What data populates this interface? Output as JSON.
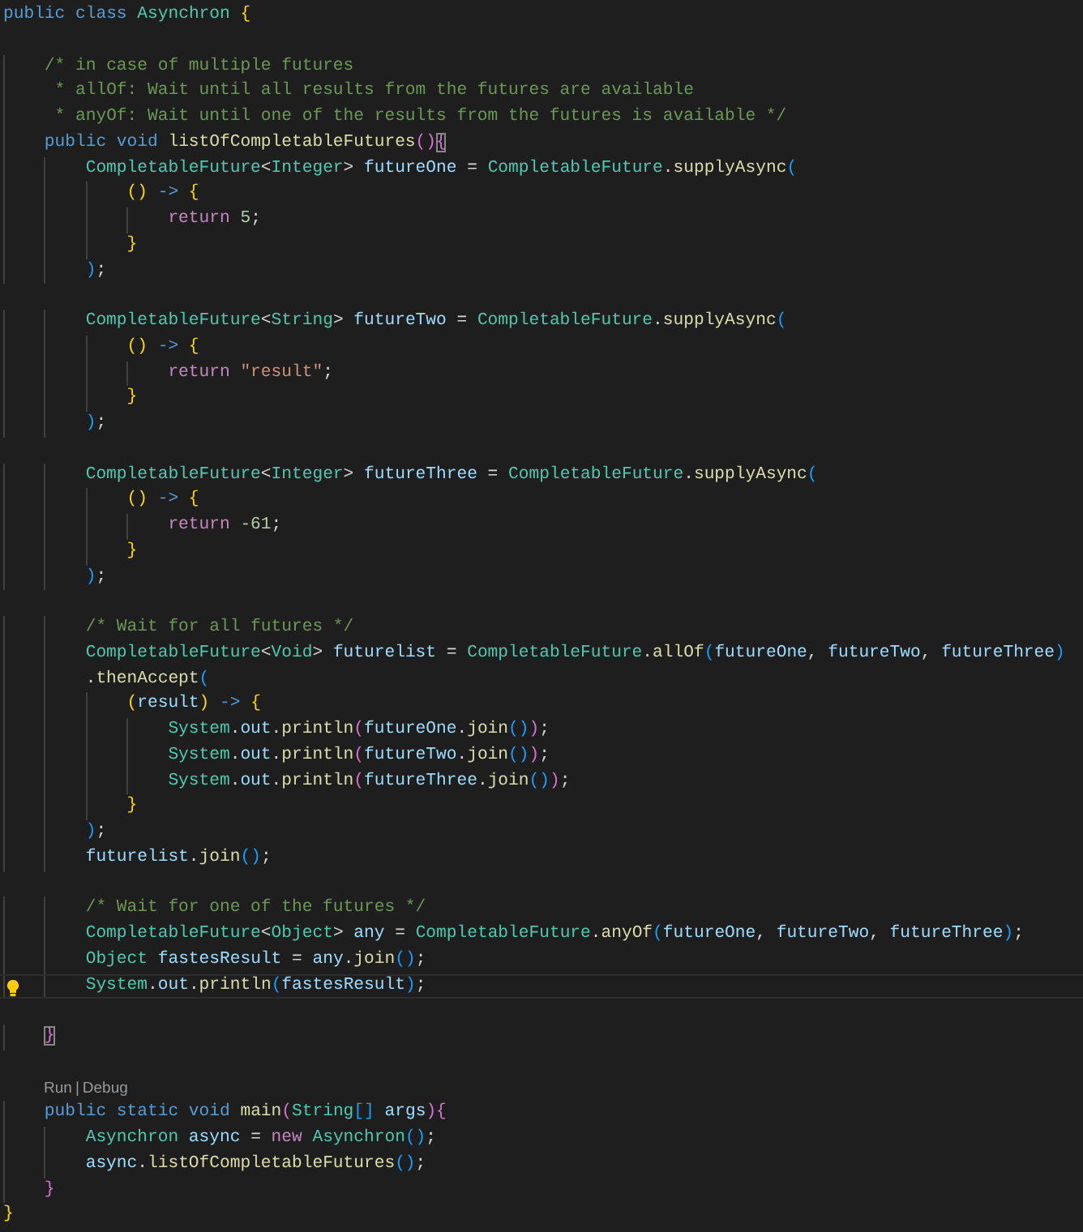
{
  "editor": {
    "lines": [
      {
        "kind": "code",
        "current": false,
        "tokens": [
          {
            "kind": "kw",
            "text": "public class "
          },
          {
            "kind": "type",
            "text": "Asynchron "
          },
          {
            "kind": "b1",
            "text": "{"
          }
        ],
        "children": [
          {
            "kind": "blank"
          },
          {
            "kind": "code",
            "current": false,
            "tokens": [
              {
                "kind": "cm",
                "text": "/* in case of multiple futures"
              }
            ]
          },
          {
            "kind": "code",
            "current": false,
            "tokens": [
              {
                "kind": "cm",
                "text": " * allOf: Wait until all results from the futures are available"
              }
            ]
          },
          {
            "kind": "code",
            "current": false,
            "tokens": [
              {
                "kind": "cm",
                "text": " * anyOf: Wait until one of the results from the futures is available */"
              }
            ]
          },
          {
            "kind": "code",
            "current": false,
            "tokens": [
              {
                "kind": "kw",
                "text": "public void "
              },
              {
                "kind": "fn",
                "text": "listOfCompletableFutures"
              },
              {
                "kind": "b2",
                "text": "()"
              },
              {
                "kind": "b2",
                "text": "{",
                "matched": true
              }
            ],
            "children": [
              {
                "kind": "code",
                "current": false,
                "tokens": [
                  {
                    "kind": "type",
                    "text": "CompletableFuture"
                  },
                  {
                    "kind": "op",
                    "text": "<"
                  },
                  {
                    "kind": "type",
                    "text": "Integer"
                  },
                  {
                    "kind": "op",
                    "text": "> "
                  },
                  {
                    "kind": "var",
                    "text": "futureOne"
                  },
                  {
                    "kind": "op",
                    "text": " = "
                  },
                  {
                    "kind": "type",
                    "text": "CompletableFuture"
                  },
                  {
                    "kind": "op",
                    "text": "."
                  },
                  {
                    "kind": "fn",
                    "text": "supplyAsync"
                  },
                  {
                    "kind": "b3",
                    "text": "("
                  }
                ],
                "children": [
                  {
                    "kind": "code",
                    "current": false,
                    "tokens": [
                      {
                        "kind": "b1",
                        "text": "()"
                      },
                      {
                        "kind": "kw",
                        "text": " -> "
                      },
                      {
                        "kind": "b1",
                        "text": "{"
                      }
                    ],
                    "children": [
                      {
                        "kind": "code",
                        "current": false,
                        "tokens": [
                          {
                            "kind": "ctl",
                            "text": "return "
                          },
                          {
                            "kind": "num",
                            "text": "5"
                          },
                          {
                            "kind": "op",
                            "text": ";"
                          }
                        ]
                      }
                    ]
                  },
                  {
                    "kind": "code",
                    "current": false,
                    "tokens": [
                      {
                        "kind": "b1",
                        "text": "}"
                      }
                    ]
                  }
                ]
              },
              {
                "kind": "code",
                "current": false,
                "tokens": [
                  {
                    "kind": "b3",
                    "text": ")"
                  },
                  {
                    "kind": "op",
                    "text": ";"
                  }
                ]
              },
              {
                "kind": "blank"
              },
              {
                "kind": "code",
                "current": false,
                "tokens": [
                  {
                    "kind": "type",
                    "text": "CompletableFuture"
                  },
                  {
                    "kind": "op",
                    "text": "<"
                  },
                  {
                    "kind": "type",
                    "text": "String"
                  },
                  {
                    "kind": "op",
                    "text": "> "
                  },
                  {
                    "kind": "var",
                    "text": "futureTwo"
                  },
                  {
                    "kind": "op",
                    "text": " = "
                  },
                  {
                    "kind": "type",
                    "text": "CompletableFuture"
                  },
                  {
                    "kind": "op",
                    "text": "."
                  },
                  {
                    "kind": "fn",
                    "text": "supplyAsync"
                  },
                  {
                    "kind": "b3",
                    "text": "("
                  }
                ],
                "children": [
                  {
                    "kind": "code",
                    "current": false,
                    "tokens": [
                      {
                        "kind": "b1",
                        "text": "()"
                      },
                      {
                        "kind": "kw",
                        "text": " -> "
                      },
                      {
                        "kind": "b1",
                        "text": "{"
                      }
                    ],
                    "children": [
                      {
                        "kind": "code",
                        "current": false,
                        "tokens": [
                          {
                            "kind": "ctl",
                            "text": "return "
                          },
                          {
                            "kind": "str",
                            "text": "\"result\""
                          },
                          {
                            "kind": "op",
                            "text": ";"
                          }
                        ]
                      }
                    ]
                  },
                  {
                    "kind": "code",
                    "current": false,
                    "tokens": [
                      {
                        "kind": "b1",
                        "text": "}"
                      }
                    ]
                  }
                ]
              },
              {
                "kind": "code",
                "current": false,
                "tokens": [
                  {
                    "kind": "b3",
                    "text": ")"
                  },
                  {
                    "kind": "op",
                    "text": ";"
                  }
                ]
              },
              {
                "kind": "blank"
              },
              {
                "kind": "code",
                "current": false,
                "tokens": [
                  {
                    "kind": "type",
                    "text": "CompletableFuture"
                  },
                  {
                    "kind": "op",
                    "text": "<"
                  },
                  {
                    "kind": "type",
                    "text": "Integer"
                  },
                  {
                    "kind": "op",
                    "text": "> "
                  },
                  {
                    "kind": "var",
                    "text": "futureThree"
                  },
                  {
                    "kind": "op",
                    "text": " = "
                  },
                  {
                    "kind": "type",
                    "text": "CompletableFuture"
                  },
                  {
                    "kind": "op",
                    "text": "."
                  },
                  {
                    "kind": "fn",
                    "text": "supplyAsync"
                  },
                  {
                    "kind": "b3",
                    "text": "("
                  }
                ],
                "children": [
                  {
                    "kind": "code",
                    "current": false,
                    "tokens": [
                      {
                        "kind": "b1",
                        "text": "()"
                      },
                      {
                        "kind": "kw",
                        "text": " -> "
                      },
                      {
                        "kind": "b1",
                        "text": "{"
                      }
                    ],
                    "children": [
                      {
                        "kind": "code",
                        "current": false,
                        "tokens": [
                          {
                            "kind": "ctl",
                            "text": "return "
                          },
                          {
                            "kind": "num",
                            "text": "-61"
                          },
                          {
                            "kind": "op",
                            "text": ";"
                          }
                        ]
                      }
                    ]
                  },
                  {
                    "kind": "code",
                    "current": false,
                    "tokens": [
                      {
                        "kind": "b1",
                        "text": "}"
                      }
                    ]
                  }
                ]
              },
              {
                "kind": "code",
                "current": false,
                "tokens": [
                  {
                    "kind": "b3",
                    "text": ")"
                  },
                  {
                    "kind": "op",
                    "text": ";"
                  }
                ]
              },
              {
                "kind": "blank"
              },
              {
                "kind": "code",
                "current": false,
                "tokens": [
                  {
                    "kind": "cm",
                    "text": "/* Wait for all futures */"
                  }
                ]
              },
              {
                "kind": "code",
                "current": false,
                "tokens": [
                  {
                    "kind": "type",
                    "text": "CompletableFuture"
                  },
                  {
                    "kind": "op",
                    "text": "<"
                  },
                  {
                    "kind": "type",
                    "text": "Void"
                  },
                  {
                    "kind": "op",
                    "text": "> "
                  },
                  {
                    "kind": "var",
                    "text": "futurelist"
                  },
                  {
                    "kind": "op",
                    "text": " = "
                  },
                  {
                    "kind": "type",
                    "text": "CompletableFuture"
                  },
                  {
                    "kind": "op",
                    "text": "."
                  },
                  {
                    "kind": "fn",
                    "text": "allOf"
                  },
                  {
                    "kind": "b3",
                    "text": "("
                  },
                  {
                    "kind": "var",
                    "text": "futureOne"
                  },
                  {
                    "kind": "op",
                    "text": ", "
                  },
                  {
                    "kind": "var",
                    "text": "futureTwo"
                  },
                  {
                    "kind": "op",
                    "text": ", "
                  },
                  {
                    "kind": "var",
                    "text": "futureThree"
                  },
                  {
                    "kind": "b3",
                    "text": ")"
                  }
                ]
              },
              {
                "kind": "code",
                "current": false,
                "tokens": [
                  {
                    "kind": "op",
                    "text": "."
                  },
                  {
                    "kind": "fn",
                    "text": "thenAccept"
                  },
                  {
                    "kind": "b3",
                    "text": "("
                  }
                ],
                "children": [
                  {
                    "kind": "code",
                    "current": false,
                    "tokens": [
                      {
                        "kind": "b1",
                        "text": "("
                      },
                      {
                        "kind": "var",
                        "text": "result"
                      },
                      {
                        "kind": "b1",
                        "text": ")"
                      },
                      {
                        "kind": "kw",
                        "text": " -> "
                      },
                      {
                        "kind": "b1",
                        "text": "{"
                      }
                    ],
                    "children": [
                      {
                        "kind": "code",
                        "current": false,
                        "tokens": [
                          {
                            "kind": "type",
                            "text": "System"
                          },
                          {
                            "kind": "op",
                            "text": "."
                          },
                          {
                            "kind": "var",
                            "text": "out"
                          },
                          {
                            "kind": "op",
                            "text": "."
                          },
                          {
                            "kind": "fn",
                            "text": "println"
                          },
                          {
                            "kind": "b2",
                            "text": "("
                          },
                          {
                            "kind": "var",
                            "text": "futureOne"
                          },
                          {
                            "kind": "op",
                            "text": "."
                          },
                          {
                            "kind": "fn",
                            "text": "join"
                          },
                          {
                            "kind": "b3",
                            "text": "()"
                          },
                          {
                            "kind": "b2",
                            "text": ")"
                          },
                          {
                            "kind": "op",
                            "text": ";"
                          }
                        ]
                      },
                      {
                        "kind": "code",
                        "current": false,
                        "tokens": [
                          {
                            "kind": "type",
                            "text": "System"
                          },
                          {
                            "kind": "op",
                            "text": "."
                          },
                          {
                            "kind": "var",
                            "text": "out"
                          },
                          {
                            "kind": "op",
                            "text": "."
                          },
                          {
                            "kind": "fn",
                            "text": "println"
                          },
                          {
                            "kind": "b2",
                            "text": "("
                          },
                          {
                            "kind": "var",
                            "text": "futureTwo"
                          },
                          {
                            "kind": "op",
                            "text": "."
                          },
                          {
                            "kind": "fn",
                            "text": "join"
                          },
                          {
                            "kind": "b3",
                            "text": "()"
                          },
                          {
                            "kind": "b2",
                            "text": ")"
                          },
                          {
                            "kind": "op",
                            "text": ";"
                          }
                        ]
                      },
                      {
                        "kind": "code",
                        "current": false,
                        "tokens": [
                          {
                            "kind": "type",
                            "text": "System"
                          },
                          {
                            "kind": "op",
                            "text": "."
                          },
                          {
                            "kind": "var",
                            "text": "out"
                          },
                          {
                            "kind": "op",
                            "text": "."
                          },
                          {
                            "kind": "fn",
                            "text": "println"
                          },
                          {
                            "kind": "b2",
                            "text": "("
                          },
                          {
                            "kind": "var",
                            "text": "futureThree"
                          },
                          {
                            "kind": "op",
                            "text": "."
                          },
                          {
                            "kind": "fn",
                            "text": "join"
                          },
                          {
                            "kind": "b3",
                            "text": "()"
                          },
                          {
                            "kind": "b2",
                            "text": ")"
                          },
                          {
                            "kind": "op",
                            "text": ";"
                          }
                        ]
                      }
                    ]
                  },
                  {
                    "kind": "code",
                    "current": false,
                    "tokens": [
                      {
                        "kind": "b1",
                        "text": "}"
                      }
                    ]
                  }
                ]
              },
              {
                "kind": "code",
                "current": false,
                "tokens": [
                  {
                    "kind": "b3",
                    "text": ")"
                  },
                  {
                    "kind": "op",
                    "text": ";"
                  }
                ]
              },
              {
                "kind": "code",
                "current": false,
                "tokens": [
                  {
                    "kind": "var",
                    "text": "futurelist"
                  },
                  {
                    "kind": "op",
                    "text": "."
                  },
                  {
                    "kind": "fn",
                    "text": "join"
                  },
                  {
                    "kind": "b3",
                    "text": "()"
                  },
                  {
                    "kind": "op",
                    "text": ";"
                  }
                ]
              },
              {
                "kind": "blank"
              },
              {
                "kind": "code",
                "current": false,
                "tokens": [
                  {
                    "kind": "cm",
                    "text": "/* Wait for one of the futures */"
                  }
                ]
              },
              {
                "kind": "code",
                "current": false,
                "tokens": [
                  {
                    "kind": "type",
                    "text": "CompletableFuture"
                  },
                  {
                    "kind": "op",
                    "text": "<"
                  },
                  {
                    "kind": "type",
                    "text": "Object"
                  },
                  {
                    "kind": "op",
                    "text": "> "
                  },
                  {
                    "kind": "var",
                    "text": "any"
                  },
                  {
                    "kind": "op",
                    "text": " = "
                  },
                  {
                    "kind": "type",
                    "text": "CompletableFuture"
                  },
                  {
                    "kind": "op",
                    "text": "."
                  },
                  {
                    "kind": "fn",
                    "text": "anyOf"
                  },
                  {
                    "kind": "b3",
                    "text": "("
                  },
                  {
                    "kind": "var",
                    "text": "futureOne"
                  },
                  {
                    "kind": "op",
                    "text": ", "
                  },
                  {
                    "kind": "var",
                    "text": "futureTwo"
                  },
                  {
                    "kind": "op",
                    "text": ", "
                  },
                  {
                    "kind": "var",
                    "text": "futureThree"
                  },
                  {
                    "kind": "b3",
                    "text": ")"
                  },
                  {
                    "kind": "op",
                    "text": ";"
                  }
                ]
              },
              {
                "kind": "code",
                "current": false,
                "tokens": [
                  {
                    "kind": "type",
                    "text": "Object "
                  },
                  {
                    "kind": "var",
                    "text": "fastesResult"
                  },
                  {
                    "kind": "op",
                    "text": " = "
                  },
                  {
                    "kind": "var",
                    "text": "any"
                  },
                  {
                    "kind": "op",
                    "text": "."
                  },
                  {
                    "kind": "fn",
                    "text": "join"
                  },
                  {
                    "kind": "b3",
                    "text": "()"
                  },
                  {
                    "kind": "op",
                    "text": ";"
                  }
                ]
              },
              {
                "kind": "code",
                "current": true,
                "lightbulb": true,
                "tokens": [
                  {
                    "kind": "type",
                    "text": "System"
                  },
                  {
                    "kind": "op",
                    "text": "."
                  },
                  {
                    "kind": "var",
                    "text": "out"
                  },
                  {
                    "kind": "op",
                    "text": "."
                  },
                  {
                    "kind": "fn",
                    "text": "println"
                  },
                  {
                    "kind": "b3",
                    "text": "("
                  },
                  {
                    "kind": "var",
                    "text": "fastesResult"
                  },
                  {
                    "kind": "b3",
                    "text": ")"
                  },
                  {
                    "kind": "op",
                    "text": ";"
                  }
                ]
              },
              {
                "kind": "blank"
              }
            ]
          },
          {
            "kind": "code",
            "current": false,
            "tokens": [
              {
                "kind": "b2",
                "text": "}",
                "matched": true
              }
            ]
          },
          {
            "kind": "blank"
          },
          {
            "kind": "codelens",
            "links": [
              "Run",
              "Debug"
            ],
            "separator": "|"
          },
          {
            "kind": "code",
            "current": false,
            "tokens": [
              {
                "kind": "kw",
                "text": "public static void "
              },
              {
                "kind": "fn",
                "text": "main"
              },
              {
                "kind": "b2",
                "text": "("
              },
              {
                "kind": "type",
                "text": "String"
              },
              {
                "kind": "b3",
                "text": "[]"
              },
              {
                "kind": "var",
                "text": " args"
              },
              {
                "kind": "b2",
                "text": ")"
              },
              {
                "kind": "b2",
                "text": "{"
              }
            ],
            "children": [
              {
                "kind": "code",
                "current": false,
                "tokens": [
                  {
                    "kind": "type",
                    "text": "Asynchron "
                  },
                  {
                    "kind": "var",
                    "text": "async"
                  },
                  {
                    "kind": "op",
                    "text": " = "
                  },
                  {
                    "kind": "ctl",
                    "text": "new "
                  },
                  {
                    "kind": "type",
                    "text": "Asynchron"
                  },
                  {
                    "kind": "b3",
                    "text": "()"
                  },
                  {
                    "kind": "op",
                    "text": ";"
                  }
                ]
              },
              {
                "kind": "code",
                "current": false,
                "tokens": [
                  {
                    "kind": "var",
                    "text": "async"
                  },
                  {
                    "kind": "op",
                    "text": "."
                  },
                  {
                    "kind": "fn",
                    "text": "listOfCompletableFutures"
                  },
                  {
                    "kind": "b3",
                    "text": "()"
                  },
                  {
                    "kind": "op",
                    "text": ";"
                  }
                ]
              }
            ]
          },
          {
            "kind": "code",
            "current": false,
            "tokens": [
              {
                "kind": "b2",
                "text": "}"
              }
            ]
          }
        ]
      },
      {
        "kind": "code",
        "current": false,
        "tokens": [
          {
            "kind": "b1",
            "text": "}"
          }
        ]
      }
    ]
  }
}
